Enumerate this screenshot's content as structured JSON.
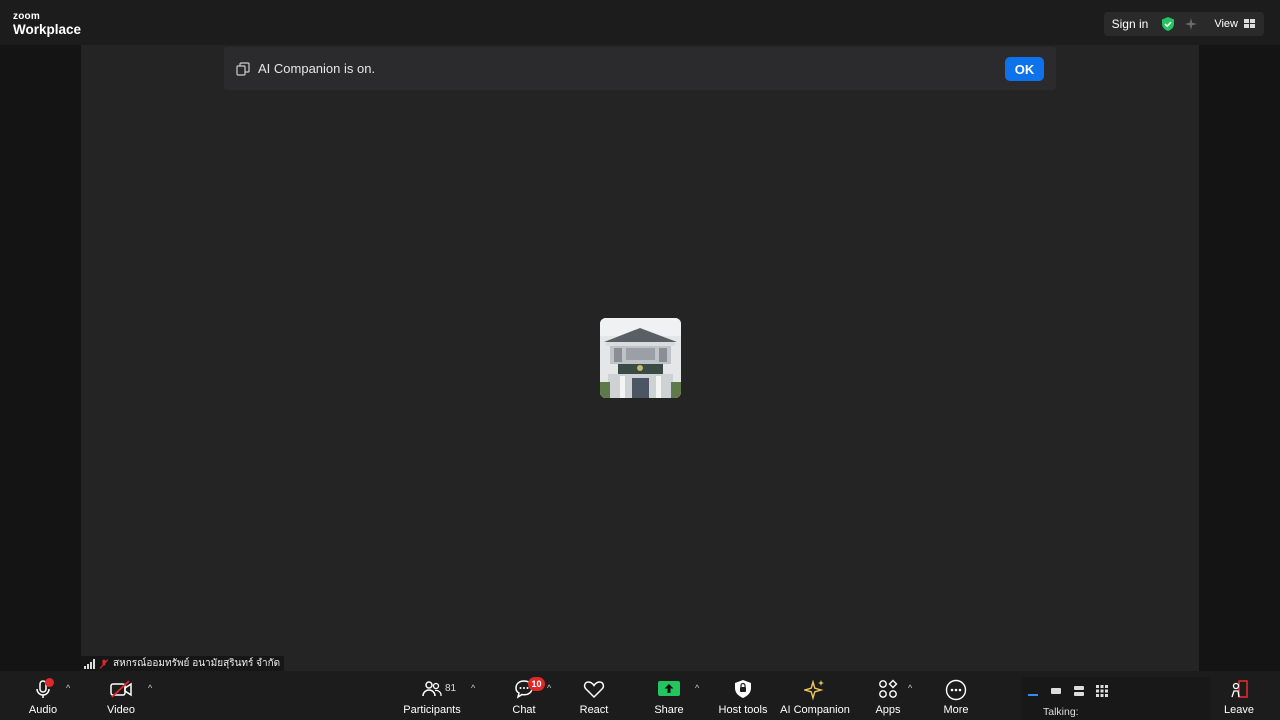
{
  "app": {
    "logo_top": "zoom",
    "logo_bottom": "Workplace"
  },
  "topbar": {
    "signin_label": "Sign in",
    "view_label": "View",
    "icons": [
      "shield-check-icon",
      "sparkle-icon",
      "grid-icon"
    ],
    "shield_color": "#22c55e"
  },
  "notice": {
    "text": "AI Companion is on.",
    "ok_label": "OK",
    "accent": "#0e72ed"
  },
  "participant": {
    "name": "สหกรณ์ออมทรัพย์ อนามัยสุรินทร์ จำกัด"
  },
  "toolbar": {
    "audio_label": "Audio",
    "video_label": "Video",
    "participants_label": "Participants",
    "participants_count": "81",
    "chat_label": "Chat",
    "chat_badge": "10",
    "react_label": "React",
    "share_label": "Share",
    "host_tools_label": "Host tools",
    "ai_companion_label": "AI Companion",
    "apps_label": "Apps",
    "more_label": "More",
    "leave_label": "Leave",
    "talking_label": "Talking:",
    "share_color": "#22c55e",
    "alert_color": "#e02828"
  }
}
